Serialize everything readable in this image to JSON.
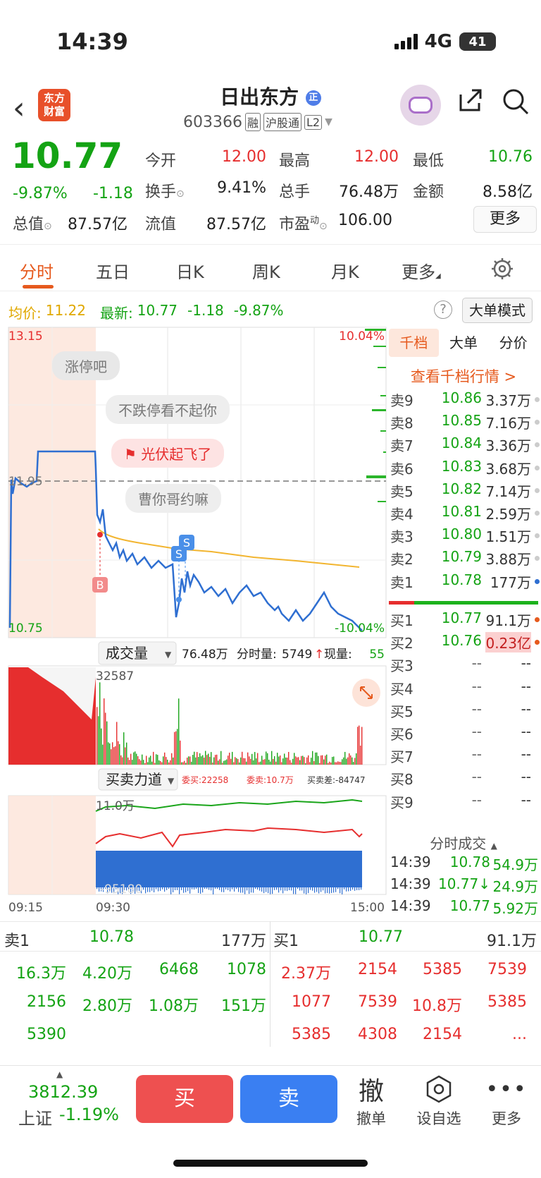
{
  "status": {
    "time": "14:39",
    "network": "4G",
    "battery": "41"
  },
  "header": {
    "logo_line1": "东方",
    "logo_line2": "财富",
    "stock_name": "日出东方",
    "badge": "正",
    "code": "603366",
    "tags": [
      "融",
      "沪股通",
      "L2"
    ]
  },
  "quote": {
    "price": "10.77",
    "change_pct": "-9.87%",
    "change": "-1.18",
    "fields": [
      {
        "label": "今开",
        "value": "12.00",
        "color": "red"
      },
      {
        "label": "最高",
        "value": "12.00",
        "color": "red"
      },
      {
        "label": "最低",
        "value": "10.76",
        "color": "green"
      },
      {
        "label": "换手",
        "value": "9.41%",
        "color": "black"
      },
      {
        "label": "总手",
        "value": "76.48万",
        "color": "black"
      },
      {
        "label": "金额",
        "value": "8.58亿",
        "color": "black"
      },
      {
        "label": "总值",
        "value": "87.57亿",
        "color": "black"
      },
      {
        "label": "流值",
        "value": "87.57亿",
        "color": "black"
      },
      {
        "label": "市盈",
        "value": "106.00",
        "color": "black",
        "sup": "动"
      }
    ],
    "more_label": "更多"
  },
  "tabs": [
    "分时",
    "五日",
    "日K",
    "周K",
    "月K",
    "更多"
  ],
  "info_bar": {
    "avg_label": "均价:",
    "avg_value": "11.22",
    "last_label": "最新:",
    "last_value": "10.77",
    "last_change": "-1.18",
    "last_pct": "-9.87%",
    "help": "?",
    "big_order_mode": "大单模式"
  },
  "chart": {
    "price_top": "13.15",
    "price_bottom": "10.75",
    "pct_top": "10.04%",
    "pct_bottom": "-10.04%",
    "ref_price": "11.95",
    "captions": [
      "涨停吧",
      "不跌停看不起你",
      "光伏起飞了",
      "曹你哥约嘛"
    ],
    "marker_b": "B",
    "marker_s": "S",
    "volume_label": "成交量",
    "volume_total": "76.48万",
    "minute_vol_label": "分时量:",
    "minute_vol": "5749",
    "current_vol_label": "现量:",
    "current_vol": "55",
    "volume_max": "32587",
    "force_label": "买卖力道",
    "force_buy": "委买:22258",
    "force_sell": "委卖:10.7万",
    "force_diff": "买卖差:-84747",
    "force_top": "11.0万",
    "force_bottom": "-95180",
    "time_start": "09:15",
    "time_open": "09:30",
    "time_end": "15:00"
  },
  "order_book": {
    "tabs": [
      "千档",
      "大单",
      "分价"
    ],
    "link": "查看千档行情 >",
    "asks": [
      {
        "label": "卖9",
        "price": "10.86",
        "vol": "3.37万"
      },
      {
        "label": "卖8",
        "price": "10.85",
        "vol": "7.16万"
      },
      {
        "label": "卖7",
        "price": "10.84",
        "vol": "3.36万"
      },
      {
        "label": "卖6",
        "price": "10.83",
        "vol": "3.68万"
      },
      {
        "label": "卖5",
        "price": "10.82",
        "vol": "7.14万"
      },
      {
        "label": "卖4",
        "price": "10.81",
        "vol": "2.59万"
      },
      {
        "label": "卖3",
        "price": "10.80",
        "vol": "1.51万"
      },
      {
        "label": "卖2",
        "price": "10.79",
        "vol": "3.88万"
      },
      {
        "label": "卖1",
        "price": "10.78",
        "vol": "177万"
      }
    ],
    "bids": [
      {
        "label": "买1",
        "price": "10.77",
        "vol": "91.1万"
      },
      {
        "label": "买2",
        "price": "10.76",
        "vol": "0.23亿"
      },
      {
        "label": "买3",
        "price": "--",
        "vol": "--"
      },
      {
        "label": "买4",
        "price": "--",
        "vol": "--"
      },
      {
        "label": "买5",
        "price": "--",
        "vol": "--"
      },
      {
        "label": "买6",
        "price": "--",
        "vol": "--"
      },
      {
        "label": "买7",
        "price": "--",
        "vol": "--"
      },
      {
        "label": "买8",
        "price": "--",
        "vol": "--"
      },
      {
        "label": "买9",
        "price": "--",
        "vol": "--"
      }
    ]
  },
  "ticks": {
    "title": "分时成交",
    "rows": [
      {
        "time": "14:39",
        "price": "10.78",
        "vol": "54.9万"
      },
      {
        "time": "14:39",
        "price": "10.77↓",
        "vol": "24.9万"
      },
      {
        "time": "14:39",
        "price": "10.77",
        "vol": "5.92万"
      }
    ]
  },
  "depth": {
    "sell_label": "卖1",
    "sell_price": "10.78",
    "sell_total": "177万",
    "buy_label": "买1",
    "buy_price": "10.77",
    "buy_total": "91.1万",
    "sell_orders": [
      "16.3万",
      "4.20万",
      "6468",
      "1078",
      "2156",
      "2.80万",
      "1.08万",
      "151万",
      "5390"
    ],
    "buy_orders": [
      "2.37万",
      "2154",
      "5385",
      "7539",
      "1077",
      "7539",
      "10.8万",
      "5385",
      "5385",
      "4308",
      "2154",
      "..."
    ]
  },
  "bottom_bar": {
    "index_value": "3812.39",
    "index_name": "上证",
    "index_pct": "-1.19%",
    "buy": "买",
    "sell": "卖",
    "cancel_icon": "撤",
    "cancel": "撤单",
    "watch": "设自选",
    "more": "更多"
  }
}
